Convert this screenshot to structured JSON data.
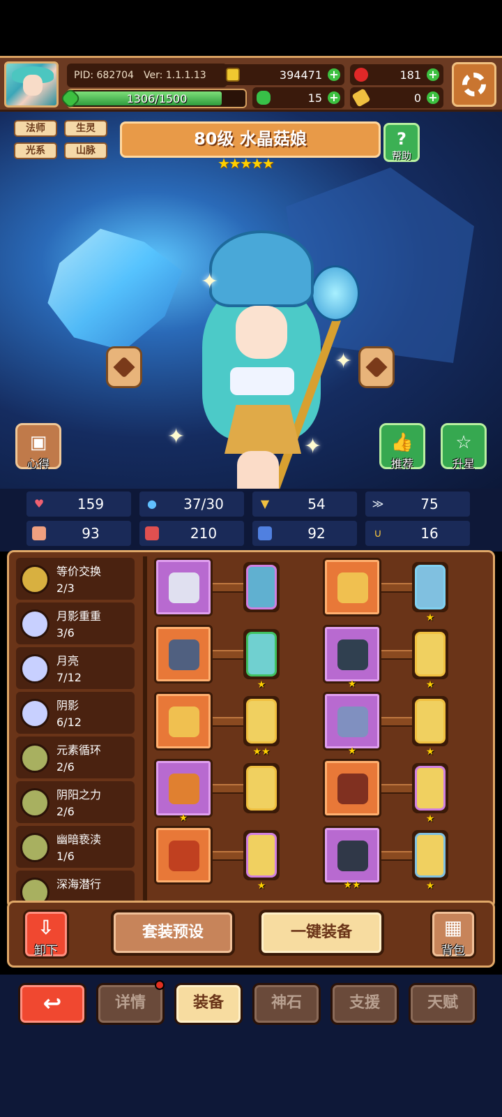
{
  "header": {
    "pid": "PID: 682704",
    "version": "Ver: 1.1.1.13",
    "coins": "394471",
    "red_gems": "181",
    "clover": "15",
    "keys": "0",
    "xp_text": "1306/1500",
    "xp_fraction": 0.87,
    "icons": {
      "coin": "coin-icon",
      "ruby": "ruby-icon",
      "clover": "clover-icon",
      "key": "key-icon",
      "settings": "gear-icon"
    }
  },
  "hero": {
    "tags": [
      "法师",
      "生灵",
      "光系",
      "山脉"
    ],
    "name": "80级 水晶菇娘",
    "stars": "★★★★★",
    "star_count": 5,
    "help_label": "帮助",
    "xinde_label": "心得",
    "recommend_label": "推荐",
    "upstar_label": "升星"
  },
  "stats": [
    {
      "icon": "heart-icon",
      "value": "159",
      "color": "#f06070"
    },
    {
      "icon": "drop-icon",
      "value": "37/30",
      "color": "#60c0ff"
    },
    {
      "icon": "shield-icon",
      "value": "54",
      "color": "#f0c040"
    },
    {
      "icon": "wing-icon",
      "value": "75",
      "color": "#e0e8f0"
    },
    {
      "icon": "fist-icon",
      "value": "93",
      "color": "#f0a080"
    },
    {
      "icon": "book-icon",
      "value": "210",
      "color": "#e05050"
    },
    {
      "icon": "boot-icon",
      "value": "92",
      "color": "#5080e0"
    },
    {
      "icon": "horseshoe-icon",
      "value": "16",
      "color": "#f0c040"
    }
  ],
  "sets": [
    {
      "name": "等价交换",
      "count": "2/3",
      "color": "#d8b040"
    },
    {
      "name": "月影重重",
      "count": "3/6",
      "color": "#c8d0ff"
    },
    {
      "name": "月亮",
      "count": "7/12",
      "color": "#c8d0ff"
    },
    {
      "name": "阴影",
      "count": "6/12",
      "color": "#c8d0ff"
    },
    {
      "name": "元素循环",
      "count": "2/6",
      "color": "#a8b060"
    },
    {
      "name": "阴阳之力",
      "count": "2/6",
      "color": "#a8b060"
    },
    {
      "name": "幽暗亵渎",
      "count": "1/6",
      "color": "#a8b060"
    },
    {
      "name": "深海潜行",
      "count": "",
      "color": "#a8b060"
    }
  ],
  "equipment": {
    "left": [
      {
        "slot": "wrench-item",
        "rarity": "purple",
        "item_color": "#e0e0f0",
        "item_stars": "",
        "gem_color": "#60b0d0",
        "gem_border": "#d080e0",
        "gem_stars": ""
      },
      {
        "slot": "dagger-item",
        "rarity": "orange",
        "item_color": "#506080",
        "item_stars": "",
        "gem_color": "#70d0d0",
        "gem_border": "#40c060",
        "gem_stars": "★"
      },
      {
        "slot": "necklace-item",
        "rarity": "orange",
        "item_color": "#f0c050",
        "item_stars": "",
        "gem_color": "#f0d060",
        "gem_border": "#f0c040",
        "gem_stars": "★★"
      },
      {
        "slot": "orb-item",
        "rarity": "purple",
        "item_color": "#e08030",
        "item_stars": "★",
        "gem_color": "#f0d060",
        "gem_border": "#f0c040",
        "gem_stars": ""
      },
      {
        "slot": "pot-item",
        "rarity": "orange",
        "item_color": "#c04020",
        "item_stars": "",
        "gem_color": "#f0d060",
        "gem_border": "#d080e0",
        "gem_stars": "★"
      }
    ],
    "right": [
      {
        "slot": "crown-item",
        "rarity": "orange",
        "item_color": "#f0c050",
        "item_stars": "",
        "gem_color": "#80c0e0",
        "gem_border": "#80d0f0",
        "gem_stars": "★"
      },
      {
        "slot": "armor-item",
        "rarity": "purple",
        "item_color": "#304050",
        "item_stars": "★",
        "gem_color": "#f0d060",
        "gem_border": "#f0c040",
        "gem_stars": "★"
      },
      {
        "slot": "gauntlet-item",
        "rarity": "purple",
        "item_color": "#8090c0",
        "item_stars": "★",
        "gem_color": "#f0d060",
        "gem_border": "#f0c040",
        "gem_stars": "★"
      },
      {
        "slot": "ring-item",
        "rarity": "orange",
        "item_color": "#803020",
        "item_stars": "",
        "gem_color": "#f0d060",
        "gem_border": "#d080e0",
        "gem_stars": "★"
      },
      {
        "slot": "boots-item",
        "rarity": "purple",
        "item_color": "#303848",
        "item_stars": "★★",
        "gem_color": "#f0d060",
        "gem_border": "#80c0e0",
        "gem_stars": "★"
      }
    ]
  },
  "actions": {
    "unequip": "卸下",
    "preset": "套装预设",
    "equip_all": "一键装备",
    "bag": "背包"
  },
  "tabs": [
    {
      "label": "",
      "icon": "back-arrow-icon",
      "kind": "back"
    },
    {
      "label": "详情",
      "kind": "inactive",
      "badge": true
    },
    {
      "label": "装备",
      "kind": "active"
    },
    {
      "label": "神石",
      "kind": "inactive"
    },
    {
      "label": "支援",
      "kind": "inactive"
    },
    {
      "label": "天赋",
      "kind": "inactive"
    }
  ]
}
